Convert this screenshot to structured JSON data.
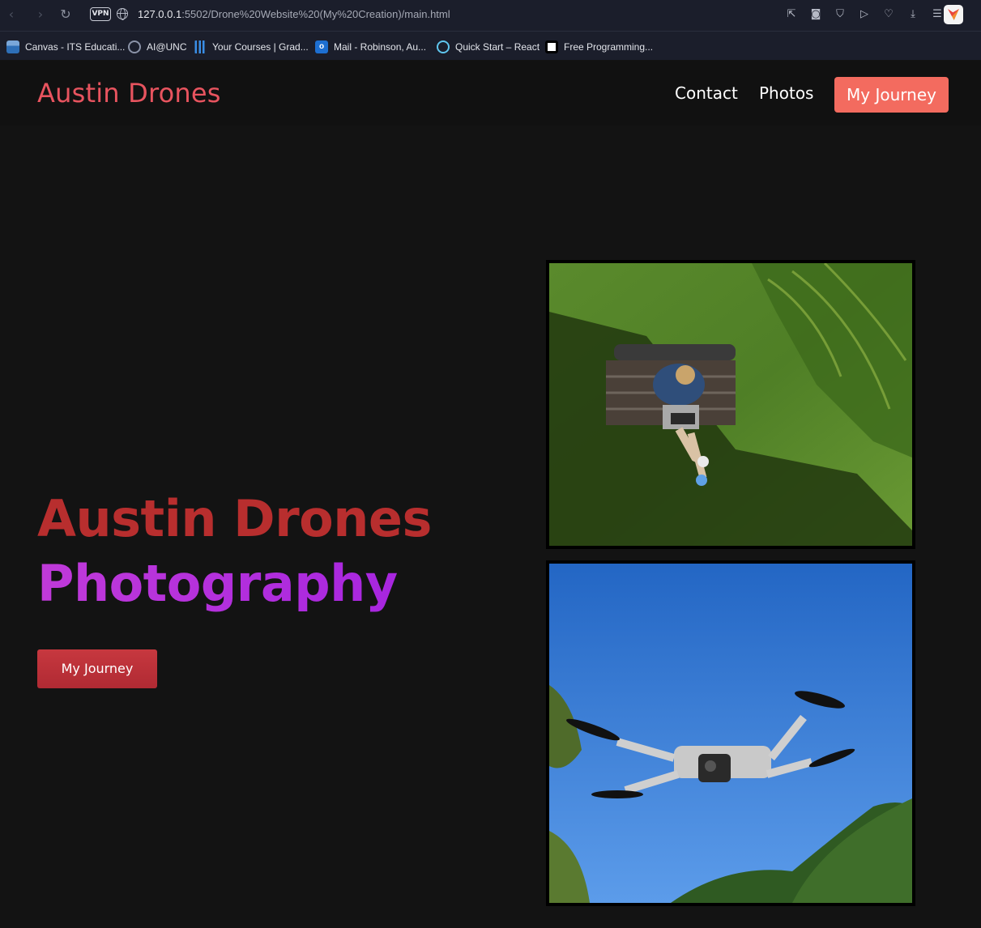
{
  "browser": {
    "url_host": "127.0.0.1",
    "url_path": ":5502/Drone%20Website%20(My%20Creation)/main.html",
    "vpn_label": "VPN",
    "bookmarks": [
      {
        "label": "Canvas - ITS Educati...",
        "icon": "canvas-icon"
      },
      {
        "label": "AI@UNC",
        "icon": "ai-icon"
      },
      {
        "label": "Your Courses | Grad...",
        "icon": "bar-chart-icon"
      },
      {
        "label": "Mail - Robinson, Au...",
        "icon": "outlook-icon"
      },
      {
        "label": "Quick Start – React",
        "icon": "react-icon"
      },
      {
        "label": "Free Programming...",
        "icon": "freecodecamp-icon"
      }
    ]
  },
  "site": {
    "logo": "Austin Drones",
    "nav": {
      "contact": "Contact",
      "photos": "Photos",
      "cta": "My Journey"
    },
    "hero": {
      "title_line1": "Austin Drones",
      "title_line2": "Photography",
      "button": "My Journey"
    },
    "photos": [
      {
        "subject": "person-on-bench-aerial-photo"
      },
      {
        "subject": "drone-in-sky-photo"
      }
    ]
  },
  "colors": {
    "accent": "#f36b5f",
    "logo": "#e8545f",
    "title_red": "#b82e2e",
    "title_purple": "#c03ad9",
    "background": "#131313"
  }
}
